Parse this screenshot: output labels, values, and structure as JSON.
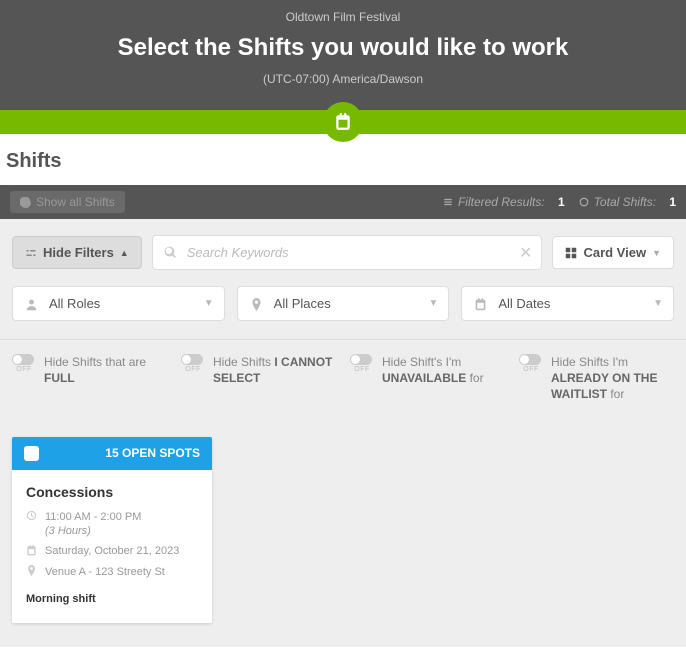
{
  "header": {
    "event_name": "Oldtown Film Festival",
    "title": "Select the Shifts you would like to work",
    "timezone": "(UTC-07:00) America/Dawson"
  },
  "section_title": "Shifts",
  "toolbar": {
    "show_all_label": "Show all Shifts",
    "filtered_label": "Filtered Results:",
    "filtered_count": "1",
    "total_label": "Total Shifts:",
    "total_count": "1"
  },
  "filters": {
    "hide_filters_label": "Hide Filters",
    "search_placeholder": "Search Keywords",
    "card_view_label": "Card View",
    "roles_label": "All Roles",
    "places_label": "All Places",
    "dates_label": "All Dates"
  },
  "toggles": {
    "off_label": "OFF",
    "full_pre": "Hide Shifts that are",
    "full_bold": "FULL",
    "cannot_pre": "Hide Shifts",
    "cannot_bold": "I CANNOT SELECT",
    "unavail_pre": "Hide Shift's I'm",
    "unavail_bold": "UNAVAILABLE",
    "unavail_post": "for",
    "waitlist_pre": "Hide Shifts I'm",
    "waitlist_bold": "ALREADY ON THE WAITLIST",
    "waitlist_post": "for"
  },
  "card": {
    "spots": "15 OPEN SPOTS",
    "role": "Concessions",
    "time": "11:00 AM - 2:00 PM",
    "duration": "(3 Hours)",
    "date": "Saturday, October 21, 2023",
    "place": "Venue A - 123 Streety St",
    "note": "Morning shift"
  }
}
